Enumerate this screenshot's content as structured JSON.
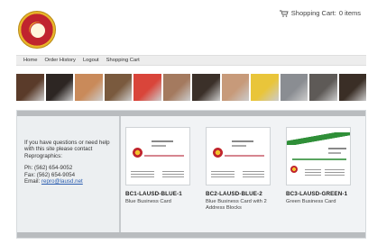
{
  "cart": {
    "label": "Shopping Cart:",
    "count": "0 items"
  },
  "nav": [
    "Home",
    "Order History",
    "Logout",
    "Shopping Cart"
  ],
  "banner": {
    "tiles": [
      "#5a3b2a",
      "#2d2623",
      "#c98a5a",
      "#7a5a3e",
      "#d9453a",
      "#a47a5f",
      "#3b3029",
      "#c79a7a",
      "#e9c53a",
      "#8a8d92",
      "#5e5a57",
      "#3a2e26"
    ]
  },
  "sidebar": {
    "help_text": "If you have questions or need help with this site please contact Reprographics:",
    "phone": "Ph: (562) 654-9052",
    "fax": "Fax: (562) 654-9054",
    "email_label": "Email:",
    "email": "repro@lausd.net"
  },
  "products": [
    {
      "sku": "BC1-LAUSD-BLUE-1",
      "description": "Blue Business Card"
    },
    {
      "sku": "BC2-LAUSD-BLUE-2",
      "description": "Blue Business Card with 2 Address Blocks"
    },
    {
      "sku": "BC3-LAUSD-GREEN-1",
      "description": "Green Business Card"
    }
  ]
}
